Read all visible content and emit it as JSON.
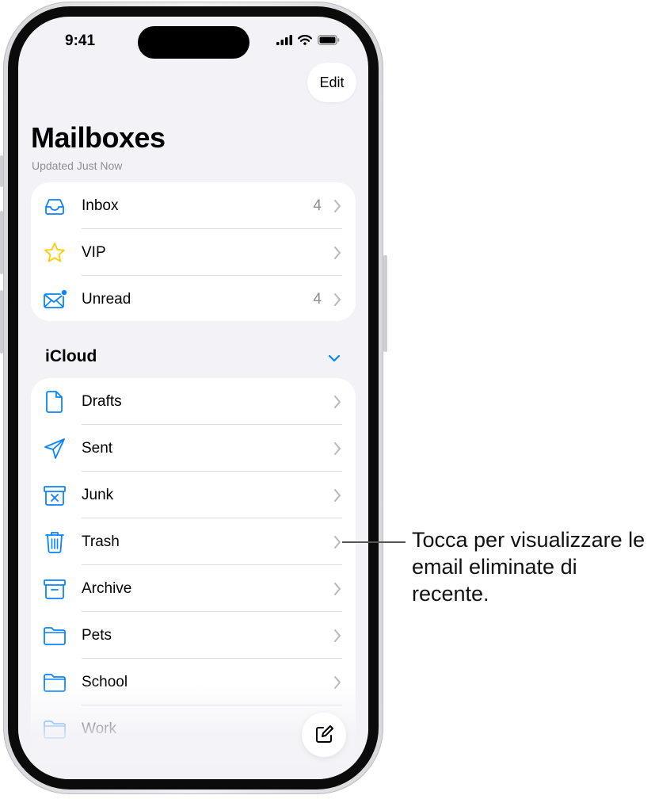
{
  "status_bar": {
    "time": "9:41"
  },
  "header": {
    "edit_label": "Edit",
    "title": "Mailboxes",
    "subtitle": "Updated Just Now"
  },
  "smart_mailboxes": [
    {
      "label": "Inbox",
      "count": "4",
      "icon": "inbox-tray-icon"
    },
    {
      "label": "VIP",
      "count": "",
      "icon": "star-icon"
    },
    {
      "label": "Unread",
      "count": "4",
      "icon": "envelope-unread-icon"
    }
  ],
  "icloud": {
    "section_title": "iCloud",
    "items": [
      {
        "label": "Drafts",
        "icon": "document-icon"
      },
      {
        "label": "Sent",
        "icon": "paper-plane-icon"
      },
      {
        "label": "Junk",
        "icon": "junk-box-icon"
      },
      {
        "label": "Trash",
        "icon": "trash-icon"
      },
      {
        "label": "Archive",
        "icon": "archive-box-icon"
      },
      {
        "label": "Pets",
        "icon": "folder-icon"
      },
      {
        "label": "School",
        "icon": "folder-icon"
      },
      {
        "label": "Work",
        "icon": "folder-icon"
      }
    ]
  },
  "callout": {
    "text": "Tocca per visualizzare le email eliminate di recente."
  },
  "colors": {
    "accent": "#0a84ff",
    "vip_star": "#ffcc00",
    "background": "#f2f2f7",
    "secondary_text": "#8e8e93"
  }
}
